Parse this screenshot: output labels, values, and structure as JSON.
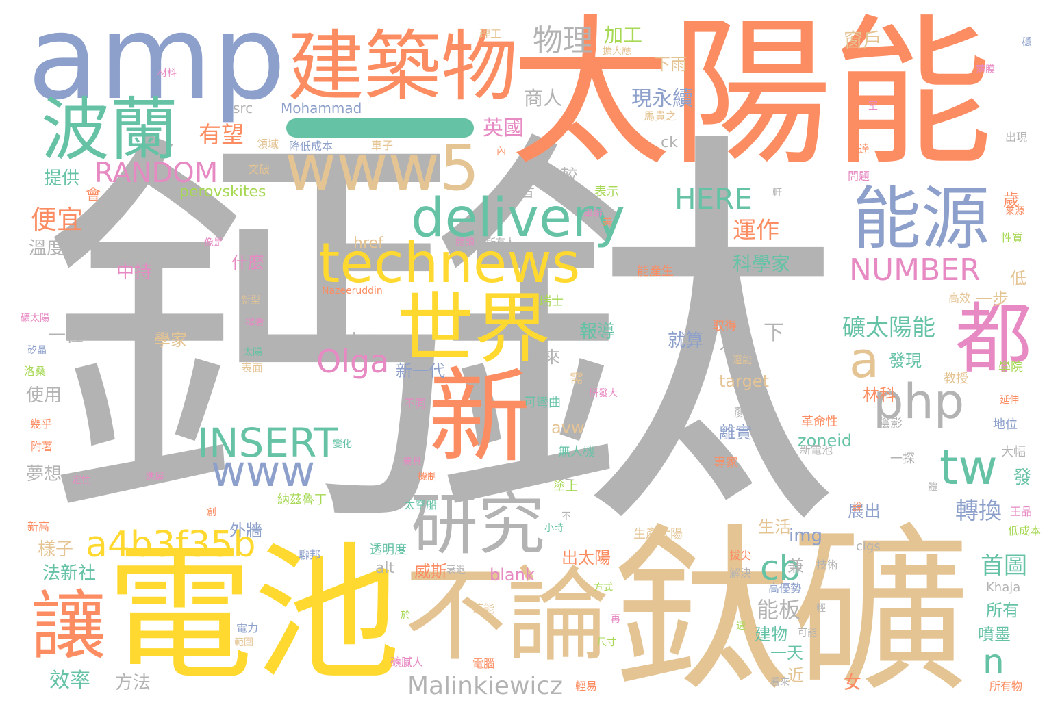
{
  "palette": {
    "gray": "#b3b3b3",
    "orange": "#fc8d62",
    "blue": "#8da0cb",
    "green": "#66c2a5",
    "yellow": "#ffd92f",
    "tan": "#e5c494",
    "pink": "#e78ac3",
    "lime": "#a6d854"
  },
  "words": [
    {
      "text": "鈣鈦",
      "color": "gray"
    },
    {
      "text": "太陽能",
      "color": "orange"
    },
    {
      "text": "amp",
      "color": "blue"
    },
    {
      "text": "鈦礦",
      "color": "tan"
    },
    {
      "text": "電池",
      "color": "yellow"
    },
    {
      "text": "建築物",
      "color": "orange"
    },
    {
      "text": "波蘭",
      "color": "green"
    },
    {
      "text": "www5",
      "color": "tan"
    },
    {
      "text": "能源",
      "color": "blue"
    },
    {
      "text": "新",
      "color": "orange"
    },
    {
      "text": "不論",
      "color": "tan"
    },
    {
      "text": "世界",
      "color": "yellow"
    },
    {
      "text": "technews",
      "color": "yellow"
    },
    {
      "text": "delivery",
      "color": "green"
    },
    {
      "text": "都",
      "color": "pink"
    },
    {
      "text": "研究",
      "color": "gray"
    },
    {
      "text": "讓",
      "color": "orange"
    },
    {
      "text": "www",
      "color": "blue"
    },
    {
      "text": "a4b3f35b",
      "color": "yellow"
    },
    {
      "text": "php",
      "color": "gray"
    },
    {
      "text": "INSERT",
      "color": "green"
    },
    {
      "text": "tw",
      "color": "green"
    },
    {
      "text": "a",
      "color": "tan"
    },
    {
      "text": "物理",
      "color": "gray"
    },
    {
      "text": "RANDOM",
      "color": "pink"
    },
    {
      "text": "NUMBER",
      "color": "pink"
    },
    {
      "text": "HERE",
      "color": "green"
    },
    {
      "text": "Olga",
      "color": "pink"
    },
    {
      "text": "cb",
      "color": "green"
    },
    {
      "text": "n",
      "color": "green"
    },
    {
      "text": "Malinkiewicz",
      "color": "gray"
    },
    {
      "text": "礦太陽能",
      "color": "green"
    },
    {
      "text": "便宜",
      "color": "orange"
    },
    {
      "text": "有望",
      "color": "orange"
    },
    {
      "text": "英國",
      "color": "pink"
    },
    {
      "text": "加工",
      "color": "lime"
    },
    {
      "text": "下雨",
      "color": "tan"
    },
    {
      "text": "窗戶",
      "color": "tan"
    },
    {
      "text": "商人",
      "color": "gray"
    },
    {
      "text": "現永續",
      "color": "blue"
    },
    {
      "text": "運作",
      "color": "orange"
    },
    {
      "text": "科學家",
      "color": "green"
    },
    {
      "text": "轉換",
      "color": "blue"
    },
    {
      "text": "首圖",
      "color": "green"
    },
    {
      "text": "效率",
      "color": "green"
    },
    {
      "text": "提供",
      "color": "green"
    },
    {
      "text": "溫度",
      "color": "gray"
    },
    {
      "text": "中持",
      "color": "pink"
    },
    {
      "text": "使用",
      "color": "gray"
    },
    {
      "text": "夢想",
      "color": "gray"
    },
    {
      "text": "一位",
      "color": "gray"
    },
    {
      "text": "樣子",
      "color": "tan"
    },
    {
      "text": "法新社",
      "color": "green"
    },
    {
      "text": "方法",
      "color": "gray"
    },
    {
      "text": "src",
      "color": "gray"
    },
    {
      "text": "Mohammad",
      "color": "blue"
    },
    {
      "text": "perovskites",
      "color": "lime"
    },
    {
      "text": "href",
      "color": "tan"
    },
    {
      "text": "border",
      "color": "gray"
    },
    {
      "text": "target",
      "color": "tan"
    },
    {
      "text": "zoneid",
      "color": "green"
    },
    {
      "text": "img",
      "color": "blue"
    },
    {
      "text": "blank",
      "color": "pink"
    },
    {
      "text": "alt",
      "color": "gray"
    },
    {
      "text": "avw",
      "color": "tan"
    },
    {
      "text": "ck",
      "color": "gray"
    },
    {
      "text": "cigs",
      "color": "gray"
    },
    {
      "text": "Khaja",
      "color": "gray"
    },
    {
      "text": "Nazeeruddin",
      "color": "orange"
    },
    {
      "text": "降低成本",
      "color": "blue"
    },
    {
      "text": "什麼",
      "color": "pink"
    },
    {
      "text": "報導",
      "color": "green"
    },
    {
      "text": "學家",
      "color": "tan"
    },
    {
      "text": "新一代",
      "color": "blue"
    },
    {
      "text": "就算",
      "color": "blue"
    },
    {
      "text": "人類",
      "color": "gray"
    },
    {
      "text": "發現",
      "color": "green"
    },
    {
      "text": "林科",
      "color": "orange"
    },
    {
      "text": "離實",
      "color": "blue"
    },
    {
      "text": "展出",
      "color": "blue"
    },
    {
      "text": "生活",
      "color": "tan"
    },
    {
      "text": "出太陽",
      "color": "orange"
    },
    {
      "text": "威斯",
      "color": "orange"
    },
    {
      "text": "能板",
      "color": "gray"
    },
    {
      "text": "建物",
      "color": "green"
    },
    {
      "text": "一天",
      "color": "green"
    },
    {
      "text": "所有",
      "color": "green"
    },
    {
      "text": "噴墨",
      "color": "green"
    },
    {
      "text": "一步",
      "color": "tan"
    },
    {
      "text": "歲",
      "color": "orange"
    },
    {
      "text": "低",
      "color": "tan"
    },
    {
      "text": "較",
      "color": "gray"
    },
    {
      "text": "板者",
      "color": "gray"
    },
    {
      "text": "一來",
      "color": "gray"
    },
    {
      "text": "下",
      "color": "gray"
    },
    {
      "text": "更",
      "color": "gray"
    },
    {
      "text": "兼",
      "color": "gray"
    },
    {
      "text": "女",
      "color": "orange"
    },
    {
      "text": "近",
      "color": "tan"
    },
    {
      "text": "發",
      "color": "green"
    },
    {
      "text": "外牆",
      "color": "blue"
    },
    {
      "text": "會",
      "color": "orange"
    },
    {
      "text": "表示",
      "color": "lime"
    },
    {
      "text": "能產生",
      "color": "orange"
    },
    {
      "text": "瑞士",
      "color": "lime"
    },
    {
      "text": "取得",
      "color": "orange"
    },
    {
      "text": "可彎曲",
      "color": "green"
    },
    {
      "text": "研發大",
      "color": "pink"
    },
    {
      "text": "顏色",
      "color": "gray"
    },
    {
      "text": "學院",
      "color": "lime"
    },
    {
      "text": "教授",
      "color": "tan"
    },
    {
      "text": "陰影",
      "color": "gray"
    },
    {
      "text": "地位",
      "color": "blue"
    },
    {
      "text": "革命性",
      "color": "orange"
    },
    {
      "text": "大幅",
      "color": "gray"
    },
    {
      "text": "專家",
      "color": "orange"
    },
    {
      "text": "一探",
      "color": "gray"
    },
    {
      "text": "新電池",
      "color": "gray"
    },
    {
      "text": "無人機",
      "color": "green"
    },
    {
      "text": "塗上",
      "color": "lime"
    },
    {
      "text": "生產太陽",
      "color": "tan"
    },
    {
      "text": "王品",
      "color": "pink"
    },
    {
      "text": "低成本",
      "color": "lime"
    },
    {
      "text": "透明度",
      "color": "green"
    },
    {
      "text": "技術",
      "color": "gray"
    },
    {
      "text": "高優勢",
      "color": "blue"
    },
    {
      "text": "解決",
      "color": "gray"
    },
    {
      "text": "納茲魯丁",
      "color": "lime"
    },
    {
      "text": "太空船",
      "color": "green"
    },
    {
      "text": "礦能",
      "color": "tan"
    },
    {
      "text": "礦膩人",
      "color": "pink"
    },
    {
      "text": "電腦",
      "color": "orange"
    },
    {
      "text": "看來",
      "color": "gray"
    },
    {
      "text": "所有物",
      "color": "orange"
    },
    {
      "text": "輕易",
      "color": "orange"
    },
    {
      "text": "可能",
      "color": "gray"
    },
    {
      "text": "電力",
      "color": "blue"
    },
    {
      "text": "範圍",
      "color": "tan"
    },
    {
      "text": "理工",
      "color": "tan"
    },
    {
      "text": "材料",
      "color": "pink"
    },
    {
      "text": "擴大應",
      "color": "tan"
    },
    {
      "text": "馬貴之",
      "color": "tan"
    },
    {
      "text": "領域",
      "color": "tan"
    },
    {
      "text": "突破",
      "color": "tan"
    },
    {
      "text": "車子",
      "color": "tan"
    },
    {
      "text": "已達",
      "color": "orange"
    },
    {
      "text": "問題",
      "color": "pink"
    },
    {
      "text": "出現",
      "color": "gray"
    },
    {
      "text": "來源",
      "color": "orange"
    },
    {
      "text": "性質",
      "color": "lime"
    },
    {
      "text": "薄膜",
      "color": "pink"
    },
    {
      "text": "高效",
      "color": "tan"
    },
    {
      "text": "礦太陽",
      "color": "pink"
    },
    {
      "text": "矽晶",
      "color": "blue"
    },
    {
      "text": "洛桑",
      "color": "lime"
    },
    {
      "text": "幾乎",
      "color": "orange"
    },
    {
      "text": "附著",
      "color": "orange"
    },
    {
      "text": "定性",
      "color": "pink"
    },
    {
      "text": "新高",
      "color": "orange"
    },
    {
      "text": "像是",
      "color": "pink"
    },
    {
      "text": "相關",
      "color": "gray"
    },
    {
      "text": "新型",
      "color": "tan"
    },
    {
      "text": "擇者",
      "color": "pink"
    },
    {
      "text": "太陽",
      "color": "green"
    },
    {
      "text": "表面",
      "color": "tan"
    },
    {
      "text": "不同",
      "color": "pink"
    },
    {
      "text": "變化",
      "color": "green"
    },
    {
      "text": "進展",
      "color": "pink"
    },
    {
      "text": "聯邦",
      "color": "blue"
    },
    {
      "text": "衰退",
      "color": "gray"
    },
    {
      "text": "小時",
      "color": "green"
    },
    {
      "text": "拔尖",
      "color": "orange"
    },
    {
      "text": "方式",
      "color": "lime"
    },
    {
      "text": "尺寸",
      "color": "lime"
    },
    {
      "text": "串聯",
      "color": "pink"
    },
    {
      "text": "所有人",
      "color": "gray"
    },
    {
      "text": "閱讀",
      "color": "pink"
    },
    {
      "text": "軒",
      "color": "gray"
    },
    {
      "text": "美",
      "color": "orange"
    },
    {
      "text": "內",
      "color": "orange"
    },
    {
      "text": "需",
      "color": "tan"
    },
    {
      "text": "室",
      "color": "pink"
    },
    {
      "text": "穩",
      "color": "blue"
    },
    {
      "text": "輕",
      "color": "gray"
    },
    {
      "text": "再",
      "color": "pink"
    },
    {
      "text": "速",
      "color": "lime"
    },
    {
      "text": "於",
      "color": "lime"
    },
    {
      "text": "創",
      "color": "orange"
    },
    {
      "text": "不",
      "color": "gray"
    },
    {
      "text": "機制",
      "color": "orange"
    },
    {
      "text": "業具",
      "color": "pink"
    },
    {
      "text": "體",
      "color": "gray"
    },
    {
      "text": "說",
      "color": "orange"
    },
    {
      "text": "延伸",
      "color": "orange"
    },
    {
      "text": "還能",
      "color": "tan"
    }
  ]
}
